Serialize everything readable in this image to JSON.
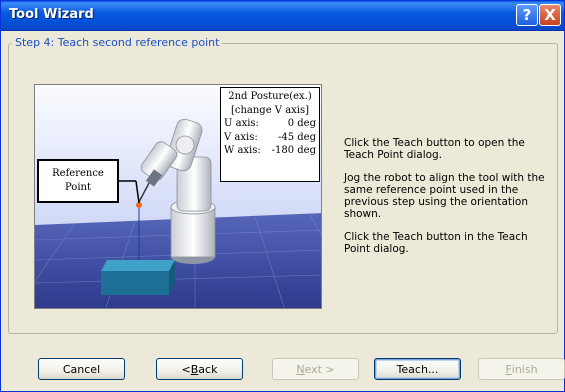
{
  "window": {
    "title": "Tool Wizard",
    "help_label": "?",
    "close_label": "X"
  },
  "step": {
    "label": "Step 4: Teach second reference point"
  },
  "illustration": {
    "posture": {
      "title": "2nd Posture(ex.)",
      "subtitle": "[change V axis]",
      "rows": [
        {
          "axis": "U axis:",
          "value": "0 deg"
        },
        {
          "axis": "V axis:",
          "value": "-45 deg"
        },
        {
          "axis": "W axis:",
          "value": "-180 deg"
        }
      ]
    },
    "reference": {
      "line1": "Reference",
      "line2": "Point"
    }
  },
  "instructions": {
    "p1": "Click the Teach button to open the Teach Point dialog.",
    "p2": "Jog the robot to align the tool with the same reference point used in the previous step using the orientation shown.",
    "p3": "Click the Teach button in the Teach Point dialog."
  },
  "buttons": {
    "cancel": "Cancel",
    "back_pre": "< ",
    "back_mn": "B",
    "back_post": "ack",
    "next_mn": "N",
    "next_post": "ext >",
    "teach": "Teach...",
    "finish_mn": "F",
    "finish_post": "inish"
  },
  "colors": {
    "title_bar": "#0a5ae0",
    "legend_text": "#1c4fc7",
    "scene_background": "#3a4aa0",
    "platform": "#1e6f96"
  }
}
